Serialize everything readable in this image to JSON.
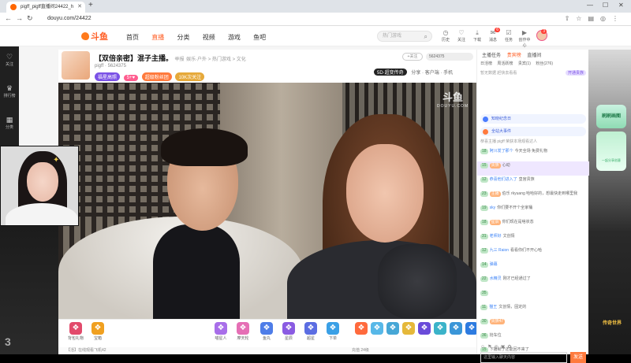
{
  "browser": {
    "tab_title": "pigff_pigff直播间24422_h",
    "url": "douyu.com/24422"
  },
  "header": {
    "logo": "斗鱼",
    "nav": [
      "首页",
      "直播",
      "分类",
      "视频",
      "游戏",
      "鱼吧"
    ],
    "search_placeholder": "热门游戏",
    "items": [
      {
        "label": "历史",
        "icon": "clock-icon"
      },
      {
        "label": "关注",
        "icon": "heart-icon"
      },
      {
        "label": "下载",
        "icon": "download-icon"
      },
      {
        "label": "消息",
        "icon": "bell-icon",
        "badge": "6"
      },
      {
        "label": "任务",
        "icon": "task-icon"
      },
      {
        "label": "创作中心",
        "icon": "video-icon"
      }
    ],
    "avatar_badge": "3"
  },
  "rail": {
    "items": [
      {
        "label": "关注",
        "icon": "heart-icon"
      },
      {
        "label": "排行榜",
        "icon": "rank-icon"
      },
      {
        "label": "分类",
        "icon": "grid-icon"
      }
    ]
  },
  "room": {
    "title": "【双倍亲密】混子主播。",
    "category": "举报",
    "breadcrumb": "娱乐·户外 > 热门游戏 > 文化",
    "streamer": "pigff",
    "fans_count": "5624375",
    "follow": "+关注",
    "tags": [
      "福星高照",
      "5+♥",
      "超级粉丝团",
      "10K次关注"
    ],
    "brand": "5D·超变传奇",
    "share": "分享",
    "client": "客户端",
    "phone": "手机",
    "watermark": "斗鱼",
    "watermark_sub": "DOUYU.COM"
  },
  "gifts": [
    {
      "label": "背包礼物",
      "color": "#e24a6b"
    },
    {
      "label": "宝箱",
      "color": "#f0a020"
    },
    {
      "label": "喵星人",
      "color": "#a86ee9"
    },
    {
      "label": "摩天轮",
      "color": "#e56fb5"
    },
    {
      "label": "鱼丸",
      "color": "#4e7de8"
    },
    {
      "label": "星辰",
      "color": "#8a5be2"
    },
    {
      "label": "超星",
      "color": "#5b6de2"
    },
    {
      "label": "下单",
      "color": "#3aa0e6"
    },
    {
      "label": "火箭",
      "color": "#ff6a3d"
    },
    {
      "label": "荧光棒",
      "color": "#57b8e8"
    },
    {
      "label": "飞机",
      "color": "#47a7d6"
    },
    {
      "label": "稳",
      "color": "#e5b83a"
    },
    {
      "label": "大佬",
      "color": "#6a4bd9"
    },
    {
      "label": "666",
      "color": "#3bb3c9"
    },
    {
      "label": "礼盒",
      "color": "#3a96d8"
    },
    {
      "label": "宝藏",
      "color": "#2d7be0"
    }
  ],
  "bottom_tip": "【活】在线观看飞机42",
  "bottom_stats": "充值  24级",
  "chat": {
    "tabs": [
      "主播任务",
      "贵宾榜",
      "直播间"
    ],
    "sub_tabs": [
      "日活榜",
      "周活跃榜",
      "贵宾(1)",
      "粉丝(276)"
    ],
    "current_user": "暂无数据 赶快去看看",
    "open_btn": "开通贵族",
    "notices": [
      "知晓纪念日",
      "全站大事件"
    ],
    "notice_extra": "恭喜主播 pigff 荣获本场观看达人",
    "messages": [
      {
        "level": "18",
        "medal": "",
        "nick": "阿川发了那个",
        "text": "今天全场 免费礼物",
        "hl": false
      },
      {
        "level": "15",
        "medal": "贵族",
        "nick": "",
        "text": "心动",
        "hl": true
      },
      {
        "level": "12",
        "medal": "",
        "nick": "恭喜他们进入了",
        "text": "皇宫贵族",
        "hl": false
      },
      {
        "level": "23",
        "medal": "主播",
        "nick": "",
        "text": "伯乐 rkyuang 哈哈好的，想最快走到哪里我",
        "hl": false
      },
      {
        "level": "19",
        "medal": "",
        "nick": "sky",
        "text": "你们要不开个全家桶",
        "hl": false
      },
      {
        "level": "18",
        "medal": "星辰",
        "nick": "",
        "text": "你们现在是啥状态",
        "hl": false
      },
      {
        "level": "31",
        "medal": "",
        "nick": "老师好",
        "text": "文创情",
        "hl": false
      },
      {
        "level": "12",
        "medal": "",
        "nick": "九三 Raion",
        "text": "看看你们不开心哈",
        "hl": false
      },
      {
        "level": "14",
        "medal": "",
        "nick": "弹幕",
        "text": "",
        "hl": false
      },
      {
        "level": "22",
        "medal": "",
        "nick": "水精灵",
        "text": "刚才已经通过了",
        "hl": false
      },
      {
        "level": "35",
        "medal": "",
        "nick": "",
        "text": "",
        "hl": false
      },
      {
        "level": "11",
        "medal": "",
        "nick": "猫王",
        "text": "文创情，固定的",
        "hl": false
      },
      {
        "level": "30",
        "medal": "贵族47",
        "nick": "",
        "text": "",
        "hl": false
      },
      {
        "level": "36",
        "medal": "",
        "nick": "",
        "text": "抢车位",
        "hl": false
      },
      {
        "level": "15",
        "medal": "",
        "nick": "",
        "text": "下播就了还能回不来了",
        "hl": false
      }
    ],
    "input_placeholder": "这里输入聊天内容",
    "send": "发送"
  },
  "promo": {
    "title": "刷刷画图",
    "sub": "一起分享创意"
  },
  "game_logo": "传奇世界",
  "backdrop_text": "3"
}
